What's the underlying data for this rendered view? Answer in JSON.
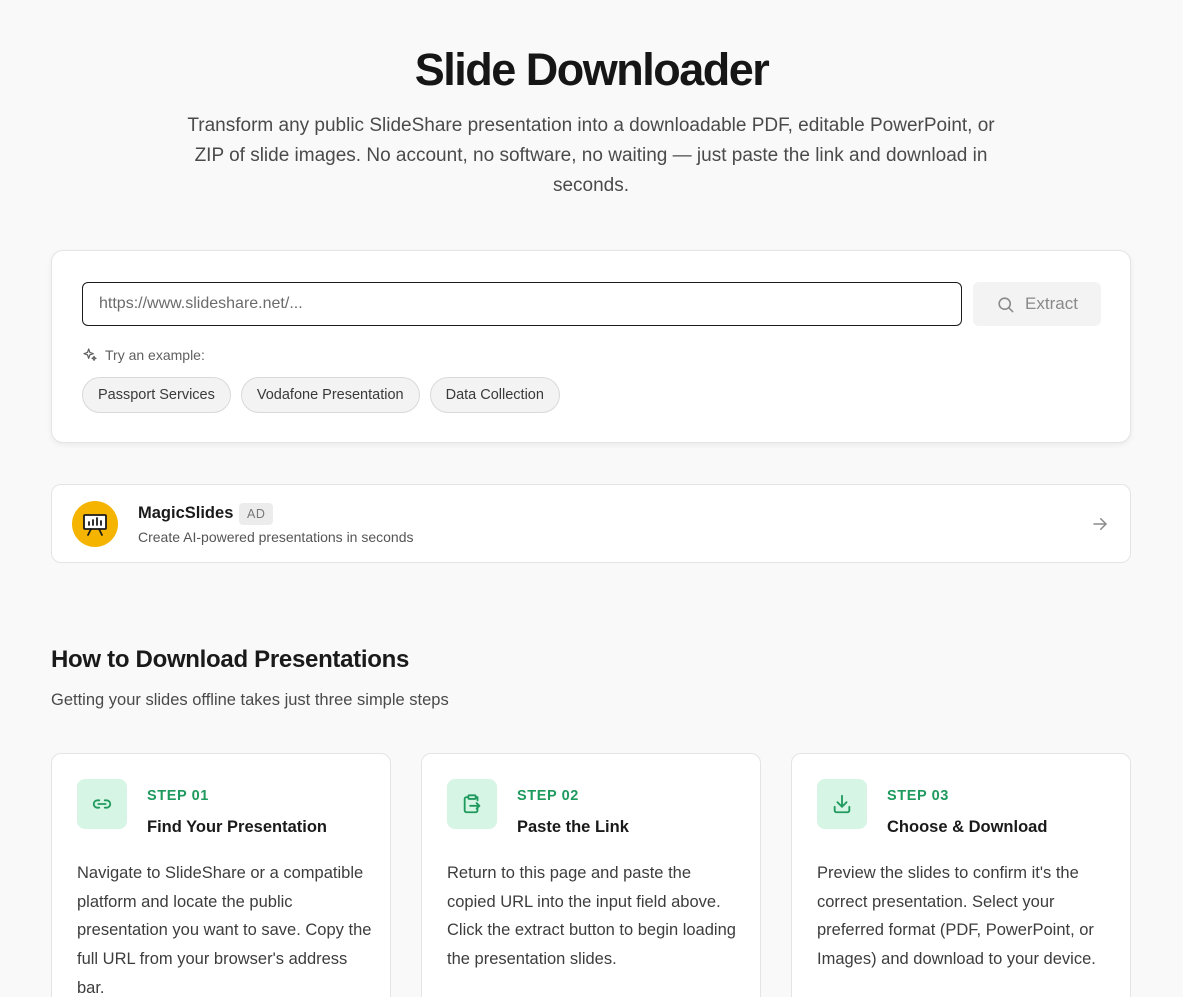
{
  "hero": {
    "title": "Slide Downloader",
    "subtitle": "Transform any public SlideShare presentation into a downloadable PDF, editable PowerPoint, or ZIP of slide images. No account, no software, no waiting — just paste the link and download in seconds."
  },
  "extractor": {
    "input_placeholder": "https://www.slideshare.net/...",
    "input_value": "",
    "button_label": "Extract",
    "button_icon": "search-icon",
    "examples_label": "Try an example:",
    "examples_icon": "sparkles-icon",
    "examples": [
      "Passport Services",
      "Vodafone Presentation",
      "Data Collection"
    ]
  },
  "ad": {
    "title": "MagicSlides",
    "badge": "AD",
    "description": "Create AI-powered presentations in seconds",
    "logo_icon": "presentation-chart-icon",
    "arrow_icon": "arrow-right-icon"
  },
  "how_to": {
    "title": "How to Download Presentations",
    "subtitle": "Getting your slides offline takes just three simple steps",
    "steps": [
      {
        "number": "STEP 01",
        "title": "Find Your Presentation",
        "icon": "link-icon",
        "text": "Navigate to SlideShare or a compatible platform and locate the public presentation you want to save. Copy the full URL from your browser's address bar."
      },
      {
        "number": "STEP 02",
        "title": "Paste the Link",
        "icon": "clipboard-paste-icon",
        "text": "Return to this page and paste the copied URL into the input field above. Click the extract button to begin loading the presentation slides."
      },
      {
        "number": "STEP 03",
        "title": "Choose & Download",
        "icon": "download-icon",
        "text": "Preview the slides to confirm it's the correct presentation. Select your preferred format (PDF, PowerPoint, or Images) and download to your device."
      }
    ]
  },
  "colors": {
    "background": "#f9f9f9",
    "accent_green": "#1f9a5e",
    "step_icon_bg": "#d7f5e4",
    "ad_logo_bg": "#f5b400"
  }
}
